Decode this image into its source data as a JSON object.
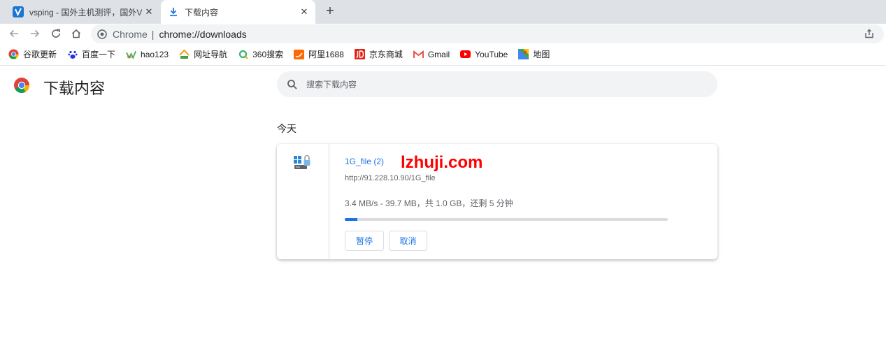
{
  "tabs": [
    {
      "title": "vsping - 国外主机测评，国外VPS",
      "close": "✕"
    },
    {
      "title": "下载内容",
      "close": "✕"
    }
  ],
  "new_tab": "+",
  "omnibox": {
    "chrome_label": "Chrome",
    "separator": "|",
    "url": "chrome://downloads"
  },
  "bookmarks": [
    {
      "label": "谷歌更新",
      "icon": "chrome-icon"
    },
    {
      "label": "百度一下",
      "icon": "baidu-paw-icon"
    },
    {
      "label": "hao123",
      "icon": "hao123-icon"
    },
    {
      "label": "网址导航",
      "icon": "2345-icon"
    },
    {
      "label": "360搜索",
      "icon": "360-search-icon"
    },
    {
      "label": "阿里1688",
      "icon": "alibaba-1688-icon"
    },
    {
      "label": "京东商城",
      "icon": "jd-icon"
    },
    {
      "label": "Gmail",
      "icon": "gmail-icon"
    },
    {
      "label": "YouTube",
      "icon": "youtube-icon"
    },
    {
      "label": "地图",
      "icon": "maps-icon"
    }
  ],
  "page": {
    "title": "下载内容",
    "search_placeholder": "搜索下载内容",
    "date_header": "今天"
  },
  "download": {
    "file_name": "1G_file (2)",
    "watermark": "lzhuji.com",
    "url": "http://91.228.10.90/1G_file",
    "progress_text": "3.4 MB/s - 39.7 MB，共 1.0 GB，还剩 5 分钟",
    "progress_fraction": 0.0397,
    "pause_label": "暂停",
    "cancel_label": "取消"
  },
  "colors": {
    "accent": "#1a73e8",
    "watermark": "#ff0000"
  }
}
